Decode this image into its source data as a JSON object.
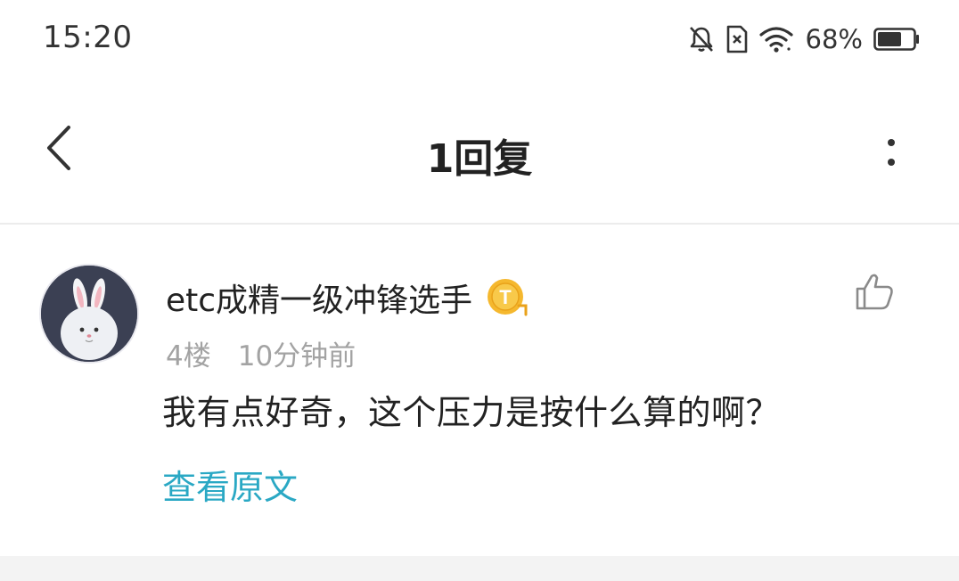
{
  "status_bar": {
    "time": "15:20",
    "battery_percent": "68%",
    "icons": [
      "bell-off-icon",
      "sim-off-icon",
      "wifi-icon",
      "battery-icon"
    ],
    "battery_level": 0.68
  },
  "header": {
    "title": "1回复",
    "back_icon": "chevron-left-icon",
    "more_icon": "more-vertical-icon"
  },
  "comment": {
    "username": "etc成精一级冲锋选手",
    "badge_icon": "coin-t-badge-icon",
    "floor": "4楼",
    "time_ago": "10分钟前",
    "text": "我有点好奇，这个压力是按什么算的啊？",
    "view_original": "查看原文",
    "like_icon": "thumbs-up-icon"
  },
  "colors": {
    "accent": "#2aa8c4",
    "meta_gray": "#a3a3a3",
    "badge_gold": "#f5b82e"
  }
}
